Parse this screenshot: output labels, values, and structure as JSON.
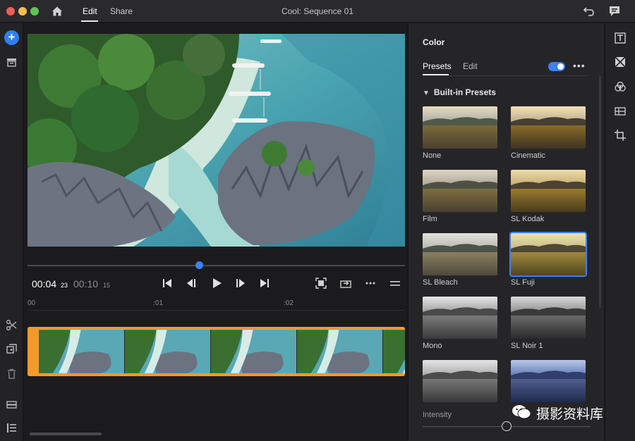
{
  "window": {
    "tabs": [
      {
        "label": "Edit",
        "active": true
      },
      {
        "label": "Share",
        "active": false
      }
    ],
    "title": "Cool: Sequence 01"
  },
  "player": {
    "current_time": "00:04",
    "current_frame": "23",
    "total_time": "00:10",
    "total_frame": "15",
    "playhead_fraction": 0.45,
    "ruler_labels": [
      "00",
      ":01",
      ":02"
    ]
  },
  "color_panel": {
    "title": "Color",
    "tabs": [
      {
        "label": "Presets",
        "active": true
      },
      {
        "label": "Edit",
        "active": false
      }
    ],
    "toggle_on": true,
    "section_label": "Built-in Presets",
    "presets": [
      {
        "label": "None",
        "selected": false
      },
      {
        "label": "Cinematic",
        "selected": false
      },
      {
        "label": "Film",
        "selected": false
      },
      {
        "label": "SL Kodak",
        "selected": false
      },
      {
        "label": "SL Bleach",
        "selected": false
      },
      {
        "label": "SL Fuji",
        "selected": true
      },
      {
        "label": "Mono",
        "selected": false
      },
      {
        "label": "SL Noir 1",
        "selected": false
      },
      {
        "label": "",
        "selected": false
      },
      {
        "label": "",
        "selected": false
      }
    ],
    "intensity_label": "Intensity",
    "intensity_fraction": 0.5
  },
  "watermark": {
    "text": "摄影资料库"
  },
  "colors": {
    "accent": "#3b82f6",
    "clip": "#f39a2a"
  },
  "icons": {
    "titlebar": [
      "home-icon",
      "undo-icon",
      "feedback-icon"
    ],
    "left_rail": [
      "add-icon",
      "media-bin-icon",
      "scissors-icon",
      "duplicate-icon",
      "trash-icon",
      "track-icon",
      "list-icon"
    ],
    "transport": [
      "go-to-start-icon",
      "step-back-icon",
      "play-icon",
      "step-forward-icon",
      "go-to-end-icon",
      "fit-icon",
      "share-icon",
      "more-icon",
      "menu-icon"
    ],
    "right_rail": [
      "titles-icon",
      "transitions-icon",
      "color-icon",
      "audio-icon",
      "crop-icon"
    ]
  }
}
